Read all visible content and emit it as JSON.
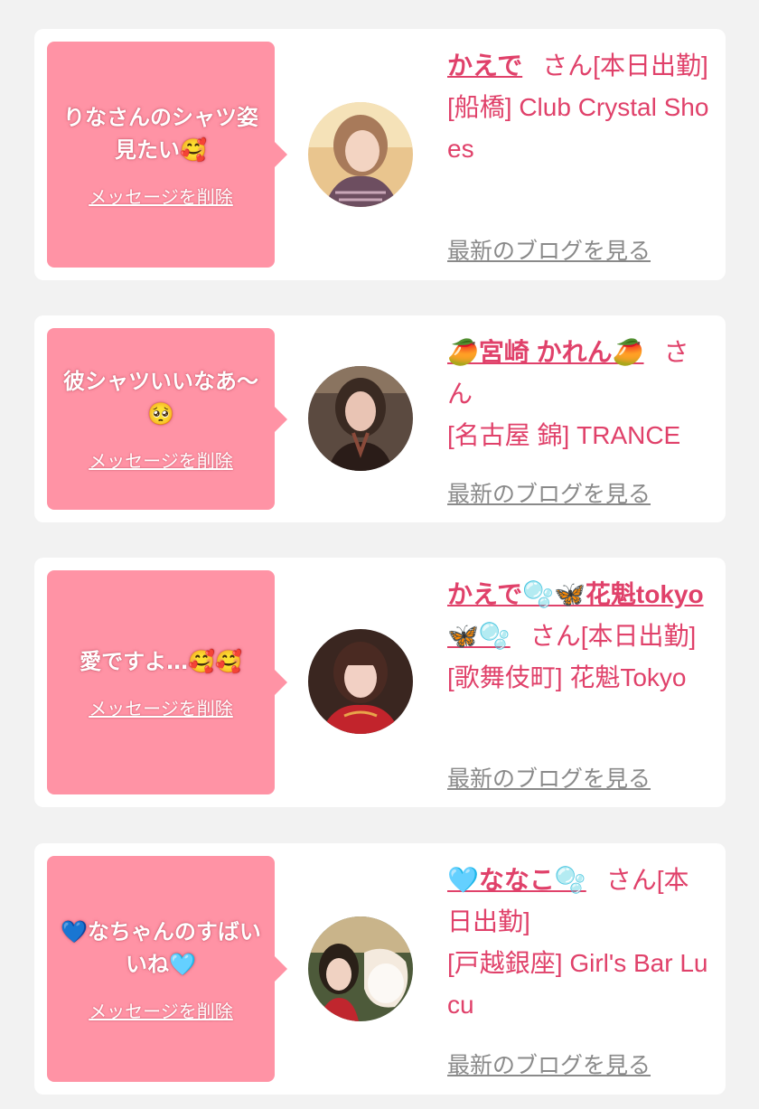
{
  "cards": [
    {
      "message": "りなさんのシャツ姿見たい🥰",
      "delete_label": "メッセージを削除",
      "name": "かえで",
      "san": "さん[本日出勤]",
      "shop": "[船橋] Club Crystal Shoes",
      "blog_label": "最新のブログを見る"
    },
    {
      "message": "彼シャツいいなあ〜🥺",
      "delete_label": "メッセージを削除",
      "name": "🥭宮崎 かれん🥭",
      "san": "さん",
      "shop": "[名古屋 錦] TRANCE",
      "blog_label": "最新のブログを見る"
    },
    {
      "message": "愛ですよ…🥰🥰",
      "delete_label": "メッセージを削除",
      "name": "かえで🫧🦋花魁tokyo🦋🫧",
      "san": "さん[本日出勤]",
      "shop": "[歌舞伎町] 花魁Tokyo",
      "blog_label": "最新のブログを見る"
    },
    {
      "message": "💙なちゃんのすばいいね🩵",
      "delete_label": "メッセージを削除",
      "name": "🩵ななこ🫧",
      "san": "さん[本日出勤]",
      "shop": "[戸越銀座] Girl's Bar Lucu",
      "blog_label": "最新のブログを見る"
    }
  ],
  "colors": {
    "bubble": "#ff93a5",
    "accent": "#e0416a",
    "muted_link": "#8a8a8a",
    "background": "#f2f2f2"
  }
}
